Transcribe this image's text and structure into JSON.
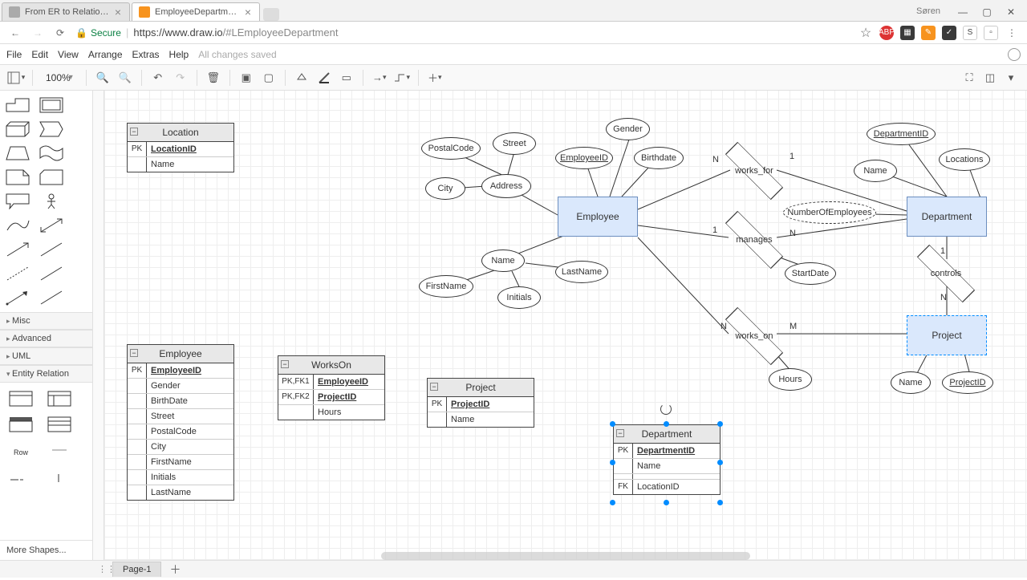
{
  "browser": {
    "tabs": [
      {
        "title": "From ER to Relational M…",
        "active": false
      },
      {
        "title": "EmployeeDepartment - d",
        "active": true
      }
    ],
    "profile": "Søren",
    "security_label": "Secure",
    "url_host": "https://www.draw.io",
    "url_path": "/#LEmployeeDepartment",
    "window_controls": {
      "min": "—",
      "max": "▢",
      "close": "✕"
    }
  },
  "menus": {
    "file": "File",
    "edit": "Edit",
    "view": "View",
    "arrange": "Arrange",
    "extras": "Extras",
    "help": "Help",
    "status": "All changes saved"
  },
  "toolbar": {
    "zoom": "100%"
  },
  "sidebar": {
    "sections": {
      "misc": "Misc",
      "advanced": "Advanced",
      "uml": "UML",
      "er": "Entity Relation"
    },
    "row_label": "Row",
    "more_shapes": "More Shapes..."
  },
  "pages": {
    "page1": "Page-1"
  },
  "er": {
    "entities": {
      "employee": "Employee",
      "department": "Department",
      "project": "Project"
    },
    "relationships": {
      "works_for": "works_for",
      "manages": "manages",
      "controls": "controls",
      "works_on": "works_on"
    },
    "attributes": {
      "gender": "Gender",
      "birthdate": "Birthdate",
      "employee_id": "EmployeeID",
      "address": "Address",
      "city": "City",
      "street": "Street",
      "postalcode": "PostalCode",
      "name_emp": "Name",
      "firstname": "FirstName",
      "lastname": "LastName",
      "initials": "Initials",
      "dept_id": "DepartmentID",
      "dept_name": "Name",
      "locations": "Locations",
      "num_emp": "NumberOfEmployees",
      "proj_name": "Name",
      "proj_id": "ProjectID",
      "hours": "Hours",
      "startdate": "StartDate"
    },
    "card": {
      "one": "1",
      "N": "N",
      "M": "M"
    }
  },
  "tables": {
    "location": {
      "title": "Location",
      "rows": [
        {
          "k": "PK",
          "v": "LocationID",
          "u": true
        },
        {
          "k": "",
          "v": "Name"
        }
      ]
    },
    "employee": {
      "title": "Employee",
      "rows": [
        {
          "k": "PK",
          "v": "EmployeeID",
          "u": true
        },
        {
          "k": "",
          "v": "Gender"
        },
        {
          "k": "",
          "v": "BirthDate"
        },
        {
          "k": "",
          "v": "Street"
        },
        {
          "k": "",
          "v": "PostalCode"
        },
        {
          "k": "",
          "v": "City"
        },
        {
          "k": "",
          "v": "FirstName"
        },
        {
          "k": "",
          "v": "Initials"
        },
        {
          "k": "",
          "v": "LastName"
        }
      ]
    },
    "workson": {
      "title": "WorksOn",
      "rows": [
        {
          "k": "PK,FK1",
          "v": "EmployeeID",
          "u": true
        },
        {
          "k": "PK,FK2",
          "v": "ProjectID",
          "u": true
        },
        {
          "k": "",
          "v": "Hours"
        }
      ]
    },
    "project": {
      "title": "Project",
      "rows": [
        {
          "k": "PK",
          "v": "ProjectID",
          "u": true
        },
        {
          "k": "",
          "v": "Name"
        }
      ]
    },
    "department": {
      "title": "Department",
      "rows": [
        {
          "k": "PK",
          "v": "DepartmentID",
          "u": true
        },
        {
          "k": "",
          "v": "Name"
        },
        {
          "k": "",
          "v": ""
        },
        {
          "k": "FK",
          "v": "LocationID"
        }
      ]
    }
  }
}
